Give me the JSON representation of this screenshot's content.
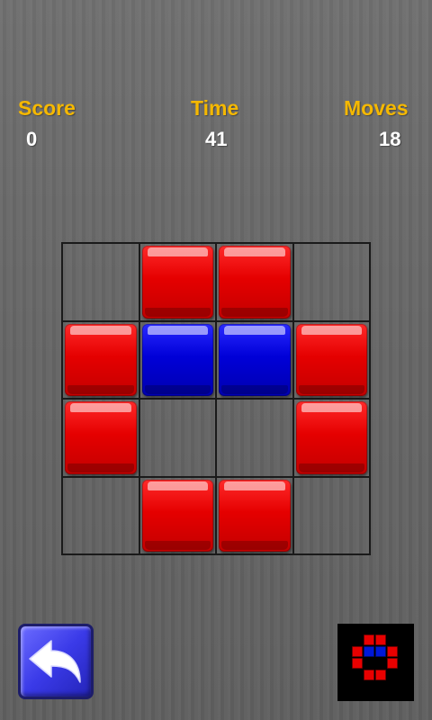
{
  "hud": {
    "score_label": "Score",
    "score_value": "0",
    "time_label": "Time",
    "time_value": "41",
    "moves_label": "Moves",
    "moves_value": "18"
  },
  "board": {
    "rows": 4,
    "cols": 4,
    "cells": [
      [
        "empty",
        "red",
        "red",
        "empty"
      ],
      [
        "red",
        "blue",
        "blue",
        "red"
      ],
      [
        "red",
        "empty",
        "empty",
        "red"
      ],
      [
        "empty",
        "red",
        "red",
        "empty"
      ]
    ]
  },
  "target_pattern": [
    [
      "empty",
      "red",
      "red",
      "empty"
    ],
    [
      "red",
      "blue",
      "blue",
      "red"
    ],
    [
      "red",
      "empty",
      "empty",
      "red"
    ],
    [
      "empty",
      "red",
      "red",
      "empty"
    ]
  ],
  "buttons": {
    "back_icon": "undo-arrow-icon"
  },
  "colors": {
    "label": "#f5b800",
    "value": "#ffffff",
    "red_tile": "#e50000",
    "blue_tile": "#0000d8",
    "button": "#3a3ae8"
  }
}
